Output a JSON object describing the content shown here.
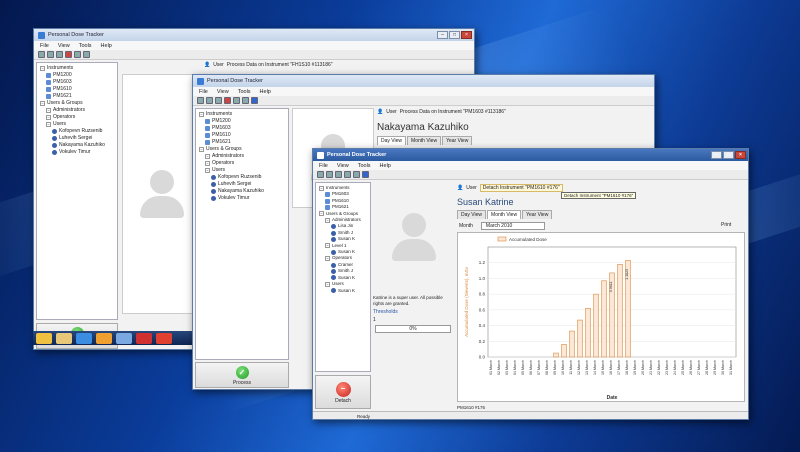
{
  "accent_colors": {
    "bar_fill": "#fbe7d6",
    "bar_stroke": "#d98a3c",
    "ylabel": "#d98a3c"
  },
  "win1": {
    "title": "Personal Dose Tracker",
    "menu": [
      "File",
      "View",
      "Tools",
      "Help"
    ],
    "status_text": "Process Data on Instrument \"FH1S10 #113186\"",
    "user_label": "User",
    "tree": [
      {
        "label": "Instruments",
        "level": 0,
        "kind": "group"
      },
      {
        "label": "PM1200",
        "level": 1,
        "kind": "device"
      },
      {
        "label": "PM1603",
        "level": 1,
        "kind": "device"
      },
      {
        "label": "PM1610",
        "level": 1,
        "kind": "device"
      },
      {
        "label": "PM1621",
        "level": 1,
        "kind": "device"
      },
      {
        "label": "Users & Groups",
        "level": 0,
        "kind": "group"
      },
      {
        "label": "Administrators",
        "level": 1,
        "kind": "group"
      },
      {
        "label": "Operators",
        "level": 1,
        "kind": "group"
      },
      {
        "label": "Users",
        "level": 1,
        "kind": "group"
      },
      {
        "label": "Kofopevn Ruzsenib",
        "level": 2,
        "kind": "person"
      },
      {
        "label": "Luhevih Sergei",
        "level": 2,
        "kind": "person"
      },
      {
        "label": "Nakayama Kazuhiko",
        "level": 2,
        "kind": "person"
      },
      {
        "label": "Vokulev Timur",
        "level": 2,
        "kind": "person"
      }
    ],
    "process_label": "Process"
  },
  "win2": {
    "title": "Personal Dose Tracker",
    "menu": [
      "File",
      "View",
      "Tools",
      "Help"
    ],
    "user_label": "User",
    "status_text": "Process Data on Instrument \"PM1603 #113186\"",
    "person_name": "Nakayama Kazuhiko",
    "tabs": [
      "Day View",
      "Month View",
      "Year View"
    ],
    "tree": [
      {
        "label": "Instruments",
        "level": 0,
        "kind": "group"
      },
      {
        "label": "PM1200",
        "level": 1,
        "kind": "device"
      },
      {
        "label": "PM1603",
        "level": 1,
        "kind": "device"
      },
      {
        "label": "PM1610",
        "level": 1,
        "kind": "device"
      },
      {
        "label": "PM1621",
        "level": 1,
        "kind": "device"
      },
      {
        "label": "Users & Groups",
        "level": 0,
        "kind": "group"
      },
      {
        "label": "Administrators",
        "level": 1,
        "kind": "group"
      },
      {
        "label": "Operators",
        "level": 1,
        "kind": "group"
      },
      {
        "label": "Users",
        "level": 1,
        "kind": "group"
      },
      {
        "label": "Kofopevn Ruzsenib",
        "level": 2,
        "kind": "person"
      },
      {
        "label": "Luhevih Sergei",
        "level": 2,
        "kind": "person"
      },
      {
        "label": "Nakayama Kazuhiko",
        "level": 2,
        "kind": "person"
      },
      {
        "label": "Vokulev Timur",
        "level": 2,
        "kind": "person"
      }
    ],
    "process_label": "Process"
  },
  "win3": {
    "title": "Personal Dose Tracker",
    "menu": [
      "File",
      "View",
      "Tools",
      "Help"
    ],
    "user_label": "User",
    "detach_tag": "Detach Instrument \"PM1610 #176\"",
    "tooltip": "Detach Instrument \"PM1610 #176\"",
    "person_name": "Susan Katrine",
    "tabs": [
      "Day View",
      "Month View",
      "Year View"
    ],
    "month_label": "Month",
    "month_value": "March 2010",
    "print_label": "Print",
    "info_text": "Katrine is a super user. All possible rights are granted.",
    "thresholds_label": "Thresholds",
    "threshold_value": "1",
    "progress_text": "0%",
    "progress_value": 0,
    "detach_button": "Detach",
    "status_device": "PM1610 #176",
    "status_ready": "Ready",
    "tree": [
      {
        "label": "Instruments",
        "level": 0,
        "kind": "group"
      },
      {
        "label": "PM1603",
        "level": 1,
        "kind": "device"
      },
      {
        "label": "PM1610",
        "level": 1,
        "kind": "device"
      },
      {
        "label": "PM1621",
        "level": 1,
        "kind": "device"
      },
      {
        "label": "Users & Groups",
        "level": 0,
        "kind": "group"
      },
      {
        "label": "Administrators",
        "level": 1,
        "kind": "group"
      },
      {
        "label": "Lisa Jin",
        "level": 2,
        "kind": "person"
      },
      {
        "label": "Smith J",
        "level": 2,
        "kind": "person"
      },
      {
        "label": "Susan K",
        "level": 2,
        "kind": "person"
      },
      {
        "label": "Level 1",
        "level": 1,
        "kind": "group"
      },
      {
        "label": "Susan K",
        "level": 2,
        "kind": "person"
      },
      {
        "label": "Operators",
        "level": 1,
        "kind": "group"
      },
      {
        "label": "Cramer",
        "level": 2,
        "kind": "person"
      },
      {
        "label": "Smith J",
        "level": 2,
        "kind": "person"
      },
      {
        "label": "Susan K",
        "level": 2,
        "kind": "person"
      },
      {
        "label": "Users",
        "level": 1,
        "kind": "group"
      },
      {
        "label": "Susan K",
        "level": 2,
        "kind": "person"
      }
    ]
  },
  "chart_data": {
    "type": "bar",
    "legend": [
      "Accumulated Dose"
    ],
    "ylabel": "Accumulated Dose (Sieverts), mSv",
    "xlabel": "Date",
    "ylim": [
      0,
      1.4
    ],
    "yticks": [
      0,
      0.2,
      0.4,
      0.6,
      0.8,
      1.0,
      1.2
    ],
    "categories": [
      "01 March",
      "02 March",
      "03 March",
      "04 March",
      "05 March",
      "06 March",
      "07 March",
      "08 March",
      "09 March",
      "10 March",
      "11 March",
      "12 March",
      "13 March",
      "14 March",
      "15 March",
      "16 March",
      "17 March",
      "18 March",
      "19 March",
      "20 March",
      "21 March",
      "22 March",
      "23 March",
      "24 March",
      "25 March",
      "26 March",
      "27 March",
      "28 March",
      "29 March",
      "30 March",
      "31 March"
    ],
    "values": [
      0,
      0,
      0,
      0,
      0,
      0,
      0,
      0,
      0.05,
      0.16,
      0.33,
      0.47,
      0.62,
      0.8,
      0.97,
      1.07,
      1.18,
      1.23,
      0,
      0,
      0,
      0,
      0,
      0,
      0,
      0,
      0,
      0,
      0,
      0,
      0
    ],
    "data_labels": {
      "15": "0.9611",
      "17": "1.1825"
    }
  }
}
